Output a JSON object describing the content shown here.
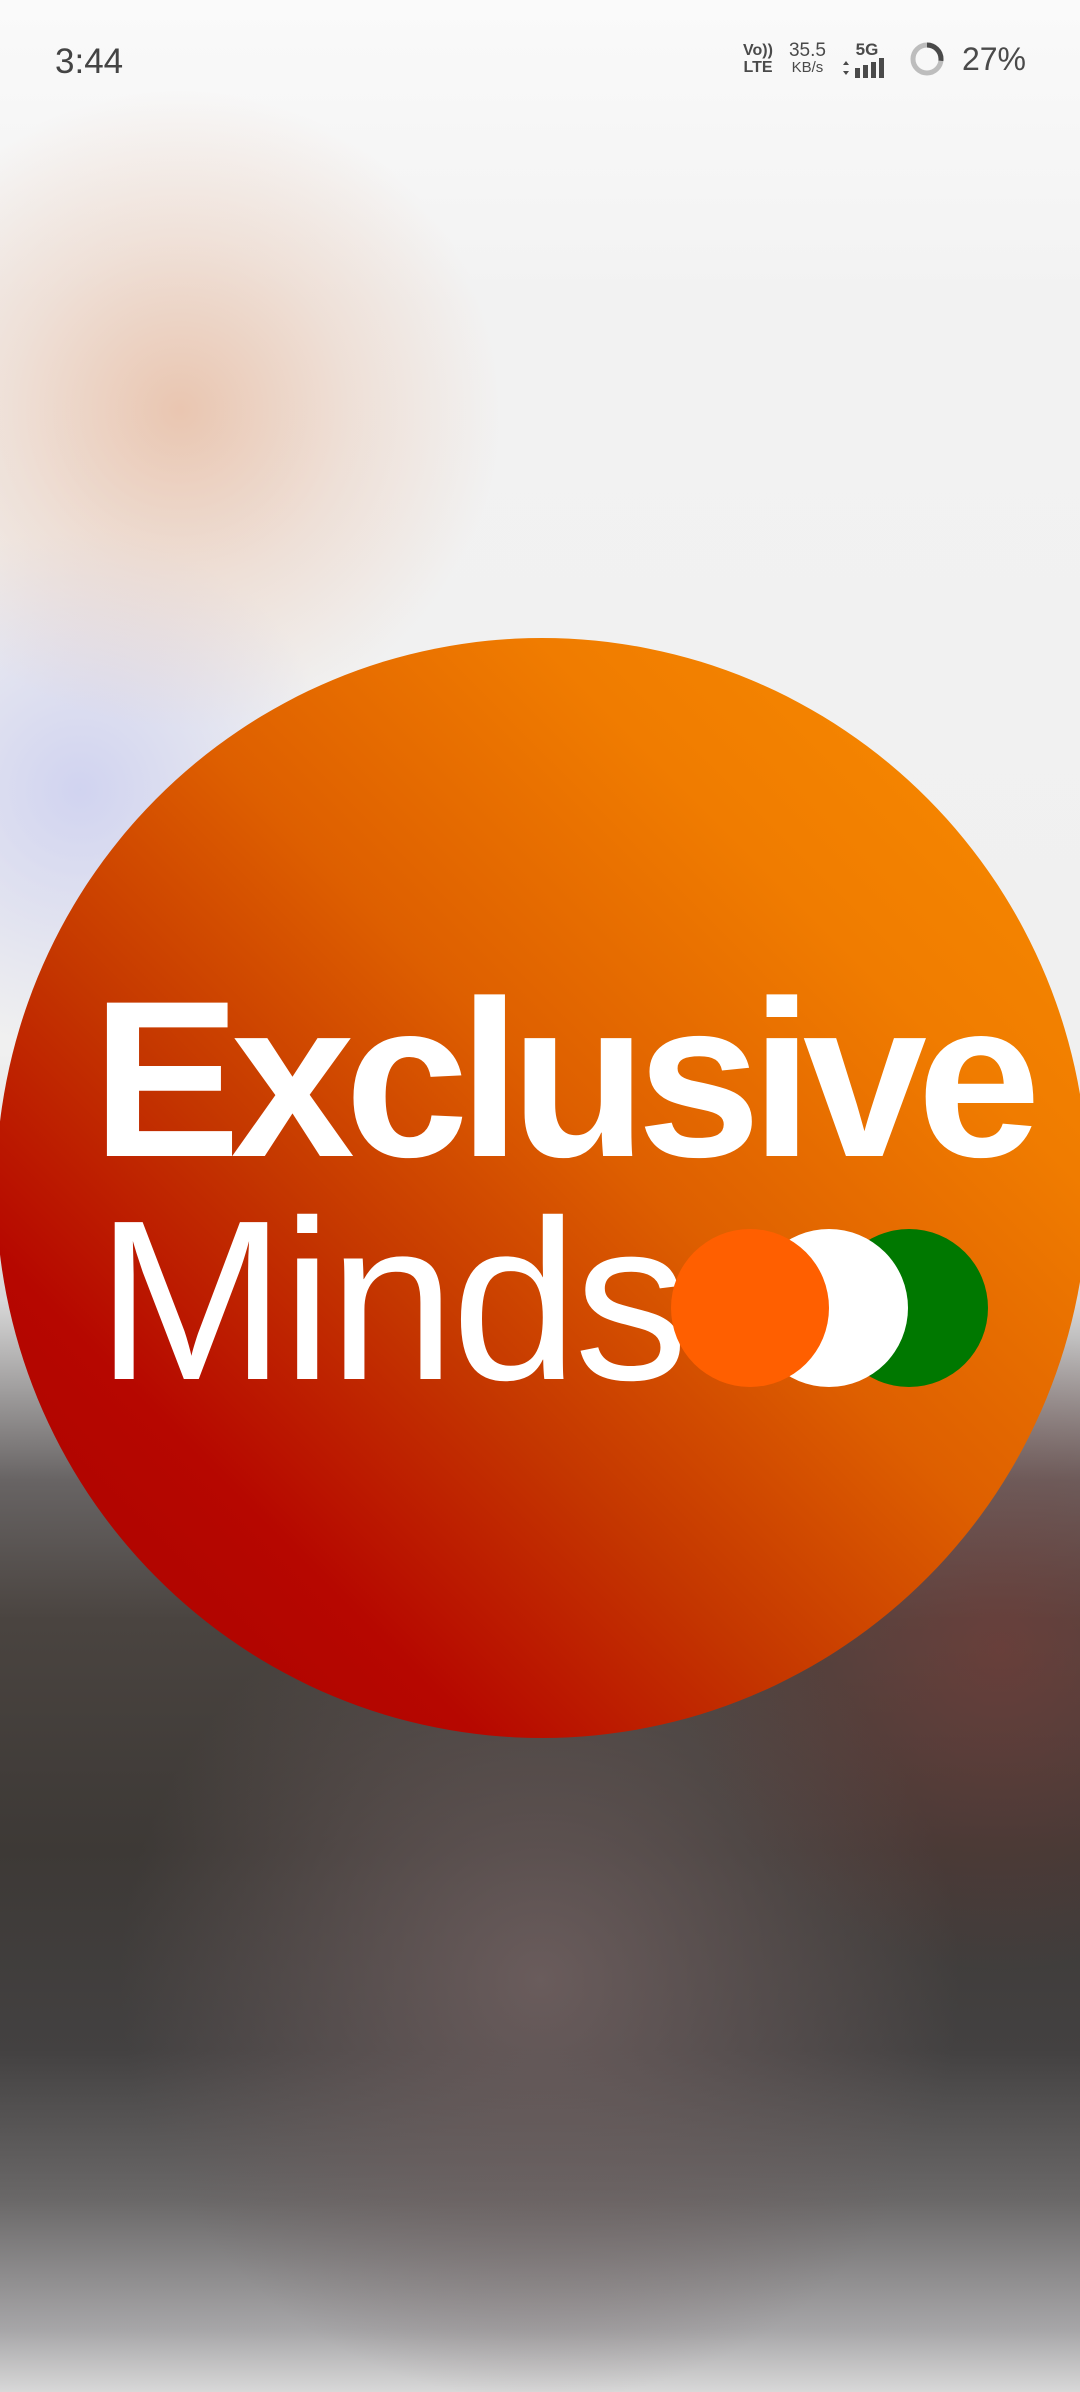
{
  "status_bar": {
    "time": "3:44",
    "volte_top": "Vo))",
    "volte_bottom": "LTE",
    "speed_value": "35.5",
    "speed_unit": "KB/s",
    "network": "5G",
    "battery_percent": "27%",
    "battery_level": 0.27,
    "icons": [
      "volte-icon",
      "signal-icon",
      "battery-ring-icon"
    ]
  },
  "logo": {
    "line1": "Exclusive",
    "line2": "Minds",
    "colors": {
      "circle_start": "#f98e00",
      "circle_end": "#a80000",
      "dot_saffron": "#ff5f00",
      "dot_white": "#ffffff",
      "dot_green": "#007800"
    }
  }
}
